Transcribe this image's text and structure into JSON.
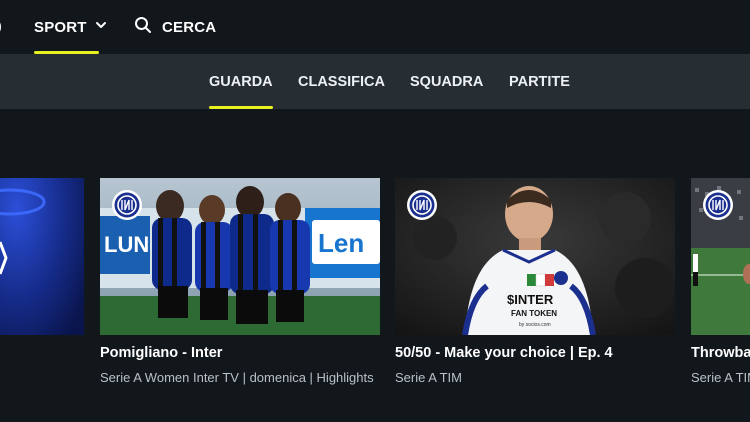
{
  "header": {
    "sport_label": "SPORT",
    "search_label": "CERCA"
  },
  "subnav": {
    "tabs": [
      {
        "label": "GUARDA",
        "active": true
      },
      {
        "label": "CLASSIFICA",
        "active": false
      },
      {
        "label": "SQUADRA",
        "active": false
      },
      {
        "label": "PARTITE",
        "active": false
      }
    ]
  },
  "cards": [
    {
      "title": "Pomigliano - Inter",
      "subtitle": "Serie A Women Inter TV | domenica | Highlights"
    },
    {
      "title": "50/50 - Make your choice | Ep. 4",
      "subtitle": "Serie A TIM"
    },
    {
      "title": "Throwba",
      "subtitle": "Serie A TIM"
    }
  ],
  "thumbs": {
    "match_banner_text": "Len",
    "match_side_text": "LUN",
    "jersey_sponsor": "$INTER",
    "jersey_sponsor_sub": "FAN TOKEN",
    "jersey_small": "by socios.com"
  },
  "colors": {
    "background": "#12171c",
    "subnav_background": "#262d33",
    "accent": "#e6f21f",
    "inter_blue": "#1b2f8f",
    "subtitle_text": "#b9c0c6"
  },
  "icons": {
    "sport_dropdown": "chevron-down-icon",
    "search": "search-icon",
    "club_badge": "inter-logo-icon"
  }
}
